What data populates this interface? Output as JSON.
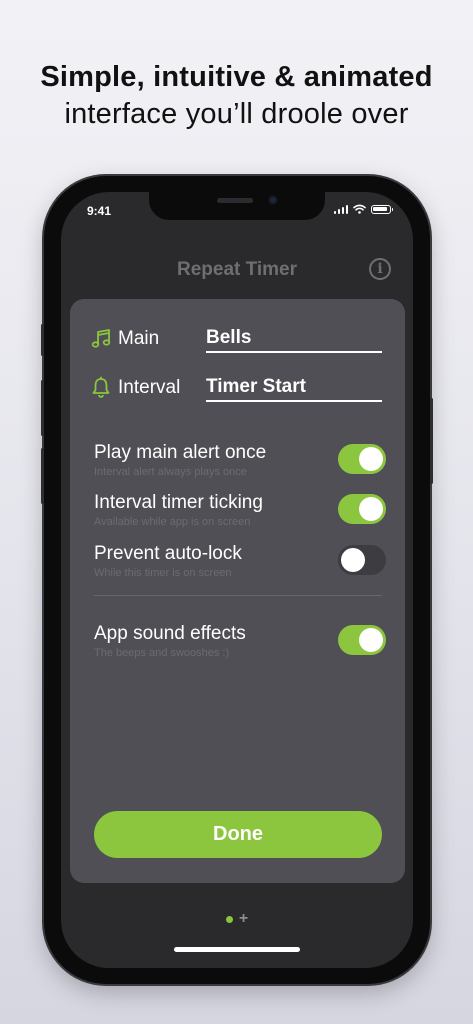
{
  "headline": {
    "line1": "Simple, intuitive & animated",
    "line2": "interface you’ll droole over"
  },
  "status_bar": {
    "time": "9:41"
  },
  "app": {
    "title": "Repeat Timer"
  },
  "sounds": [
    {
      "label": "Main",
      "value": "Bells",
      "icon": "music-note-icon"
    },
    {
      "label": "Interval",
      "value": "Timer Start",
      "icon": "bell-icon"
    }
  ],
  "options": [
    {
      "title": "Play main alert once",
      "subtitle": "Interval alert always plays once",
      "on": true
    },
    {
      "title": "Interval timer ticking",
      "subtitle": "Available while app is on screen",
      "on": true
    },
    {
      "title": "Prevent auto-lock",
      "subtitle": "While this timer is on screen",
      "on": false
    },
    {
      "title": "App sound effects",
      "subtitle": "The beeps and swooshes :)",
      "on": true
    }
  ],
  "done_label": "Done",
  "pager": {
    "pages": 1,
    "current": 0,
    "add_symbol": "+"
  },
  "colors": {
    "accent": "#8cc63f",
    "card": "#4f4f55",
    "screen": "#2a2a2d"
  }
}
